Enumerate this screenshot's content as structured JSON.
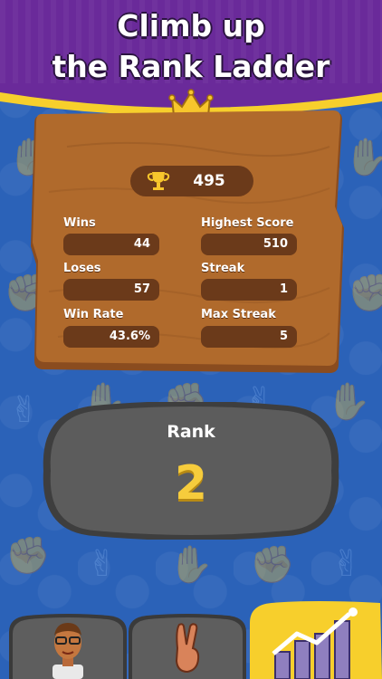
{
  "header": {
    "title_line1": "Climb up",
    "title_line2": "the Rank Ladder",
    "crown_icon": "crown-icon"
  },
  "board": {
    "trophy_icon": "trophy-icon",
    "trophies": "495",
    "stats": {
      "wins_label": "Wins",
      "wins_value": "44",
      "highest_score_label": "Highest Score",
      "highest_score_value": "510",
      "loses_label": "Loses",
      "loses_value": "57",
      "streak_label": "Streak",
      "streak_value": "1",
      "win_rate_label": "Win Rate",
      "win_rate_value": "43.6%",
      "max_streak_label": "Max Streak",
      "max_streak_value": "5"
    }
  },
  "rank": {
    "label": "Rank",
    "value": "2"
  },
  "tabs": [
    {
      "name": "profile",
      "icon": "avatar-icon",
      "active": false
    },
    {
      "name": "play",
      "icon": "peace-hand-icon",
      "active": false
    },
    {
      "name": "leaderboard",
      "icon": "chart-icon",
      "active": true
    }
  ],
  "colors": {
    "header_purple": "#6a2a9a",
    "background_blue": "#2b62b8",
    "wood": "#a8622a",
    "pill_brown": "#6b3a1a",
    "rank_gold": "#f6cc3c",
    "active_tab_yellow": "#f7cf2c"
  }
}
